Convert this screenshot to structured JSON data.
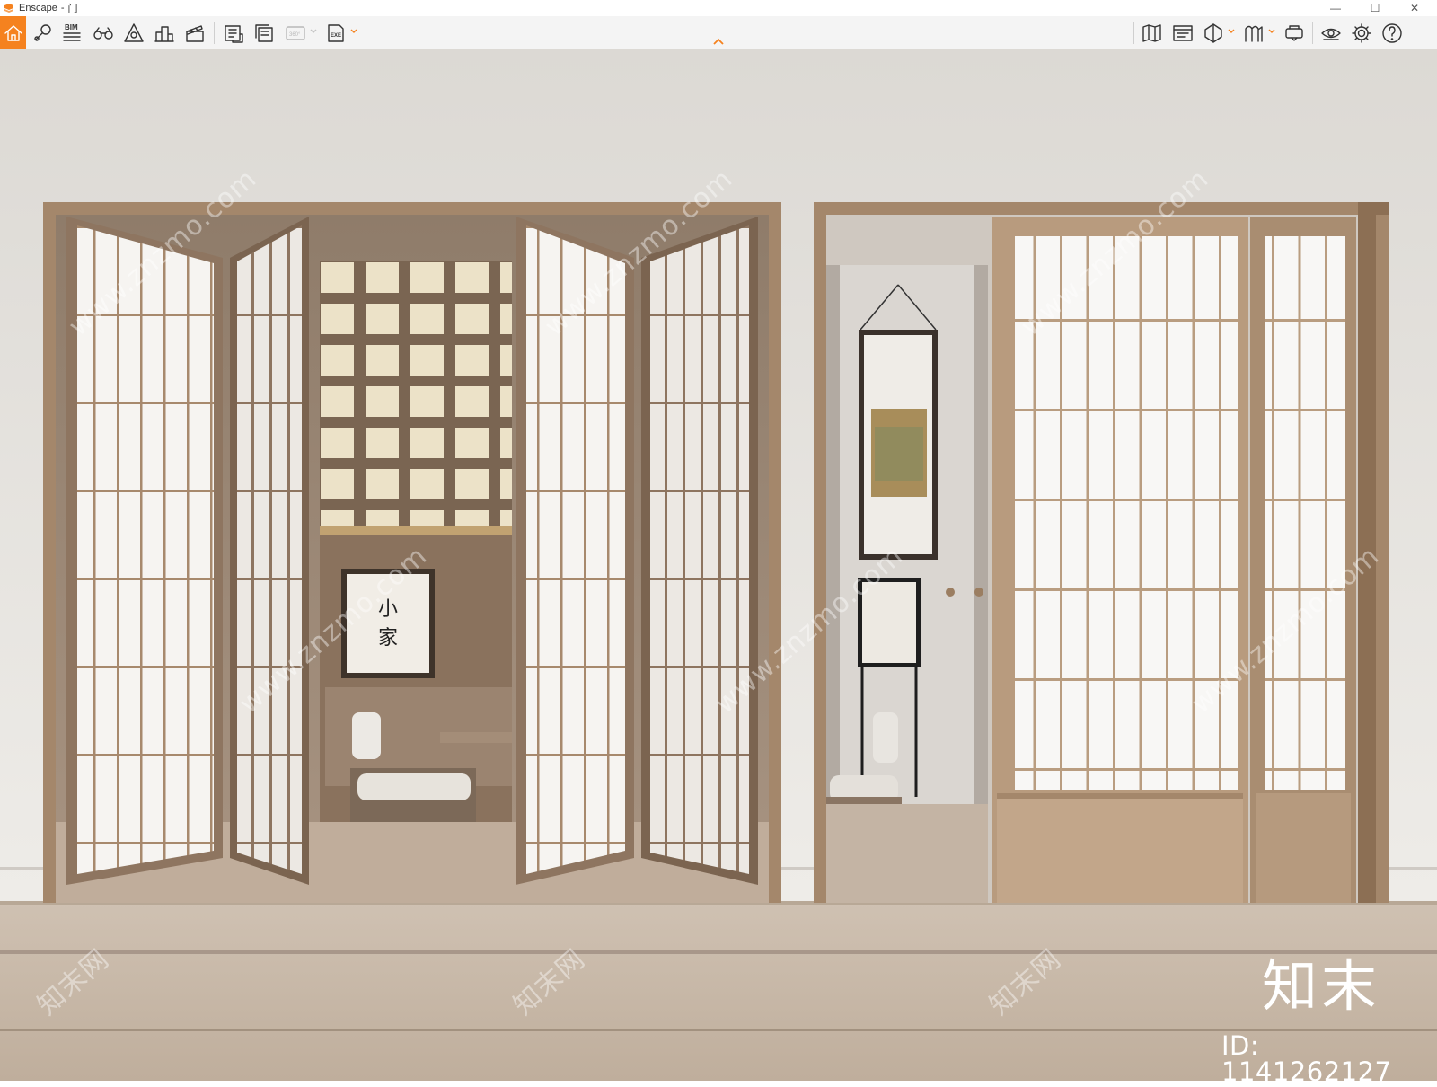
{
  "window": {
    "app_name": "Enscape",
    "separator": "-",
    "document": "门",
    "controls": {
      "minimize": "—",
      "maximize": "☐",
      "close": "✕"
    }
  },
  "toolbar": {
    "left": [
      {
        "name": "home-icon"
      },
      {
        "name": "views-icon"
      },
      {
        "name": "bim-icon",
        "label": "BIM"
      },
      {
        "name": "binoculars-icon"
      },
      {
        "name": "asset-library-icon"
      },
      {
        "name": "objects-icon"
      },
      {
        "name": "video-editor-icon"
      },
      {
        "name": "screenshot-icon"
      },
      {
        "name": "batch-render-icon"
      },
      {
        "name": "panorama-icon",
        "label": "360°",
        "disabled": true
      },
      {
        "name": "export-exe-icon",
        "label": "EXE"
      }
    ],
    "right": [
      {
        "name": "map-icon"
      },
      {
        "name": "orthographic-icon"
      },
      {
        "name": "section-icon"
      },
      {
        "name": "material-editor-icon"
      },
      {
        "name": "vr-headset-icon"
      },
      {
        "name": "visibility-icon"
      },
      {
        "name": "settings-icon"
      },
      {
        "name": "help-icon"
      }
    ],
    "collapse_icon": "chevron-up-icon",
    "accent_color": "#f5821f"
  },
  "viewport": {
    "watermark_text": "www.znzmo.com",
    "watermark_text_cn": "知末网",
    "brand": "知末",
    "image_id": "ID: 1141262127",
    "calligraphy": [
      "小",
      "家"
    ],
    "colors": {
      "wall": "#e6e4e0",
      "wood": "#a88c72",
      "paper": "#f6f4f1",
      "floor": "#c7b7a6"
    }
  }
}
